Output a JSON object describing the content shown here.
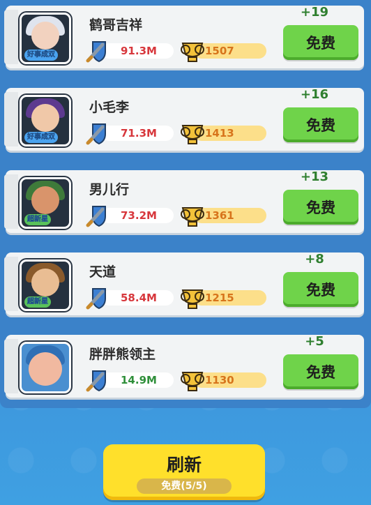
{
  "players": [
    {
      "name": "鹤哥吉祥",
      "power": "91.3M",
      "power_color": "#d7373c",
      "trophies": "1507",
      "reward": "+19",
      "button": "免费",
      "badge": "好事成双",
      "badge_color": "#4aa3ef",
      "theme": "white-hair"
    },
    {
      "name": "小毛李",
      "power": "71.3M",
      "power_color": "#d7373c",
      "trophies": "1413",
      "reward": "+16",
      "button": "免费",
      "badge": "好事成双",
      "badge_color": "#4aa3ef",
      "theme": "purple-hair"
    },
    {
      "name": "男儿行",
      "power": "73.2M",
      "power_color": "#d7373c",
      "trophies": "1361",
      "reward": "+13",
      "button": "免费",
      "badge": "超新星",
      "badge_color": "#59c25a",
      "theme": "green-helmet"
    },
    {
      "name": "天道",
      "power": "58.4M",
      "power_color": "#d7373c",
      "trophies": "1215",
      "reward": "+8",
      "button": "免费",
      "badge": "超新星",
      "badge_color": "#59c25a",
      "theme": "brown-hair"
    },
    {
      "name": "胖胖熊领主",
      "power": "14.9M",
      "power_color": "#2f8f3a",
      "trophies": "1130",
      "reward": "+5",
      "button": "免费",
      "badge": "",
      "badge_color": "#59c25a",
      "theme": "chubby"
    }
  ],
  "refresh": {
    "label": "刷新",
    "sub": "免费(5/5)"
  },
  "icons": {
    "power": "sword-shield-icon",
    "trophy": "trophy-icon"
  }
}
